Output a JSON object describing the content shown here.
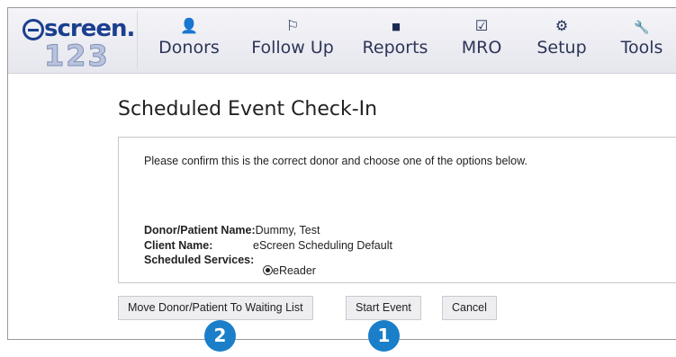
{
  "logo": {
    "word": "screen.",
    "number": "123"
  },
  "nav": {
    "items": [
      {
        "label": "Donors",
        "icon": "person-icon",
        "glyph": "👤"
      },
      {
        "label": "Follow Up",
        "icon": "flag-icon",
        "glyph": "⚐"
      },
      {
        "label": "Reports",
        "icon": "bar-chart-icon",
        "glyph": "▮▮"
      },
      {
        "label": "MRO",
        "icon": "clipboard-check-icon",
        "glyph": "☑"
      },
      {
        "label": "Setup",
        "icon": "gear-icon",
        "glyph": "⚙"
      },
      {
        "label": "Tools",
        "icon": "wrench-icon",
        "glyph": "🔧"
      }
    ]
  },
  "page": {
    "title": "Scheduled Event Check-In",
    "message": "Please confirm this is the correct donor and choose one of the options below.",
    "donor_label": "Donor/Patient Name:",
    "donor_value": "Dummy, Test",
    "client_label": "Client Name:",
    "client_value": "eScreen Scheduling Default",
    "services_label": "Scheduled Services:",
    "service_option": "eReader"
  },
  "buttons": {
    "move": "Move Donor/Patient To Waiting List",
    "start": "Start Event",
    "cancel": "Cancel"
  },
  "callouts": {
    "one": "1",
    "two": "2"
  },
  "colors": {
    "callout": "#1a7fc8",
    "nav_text": "#2e3556",
    "logo": "#1b3f8f"
  }
}
